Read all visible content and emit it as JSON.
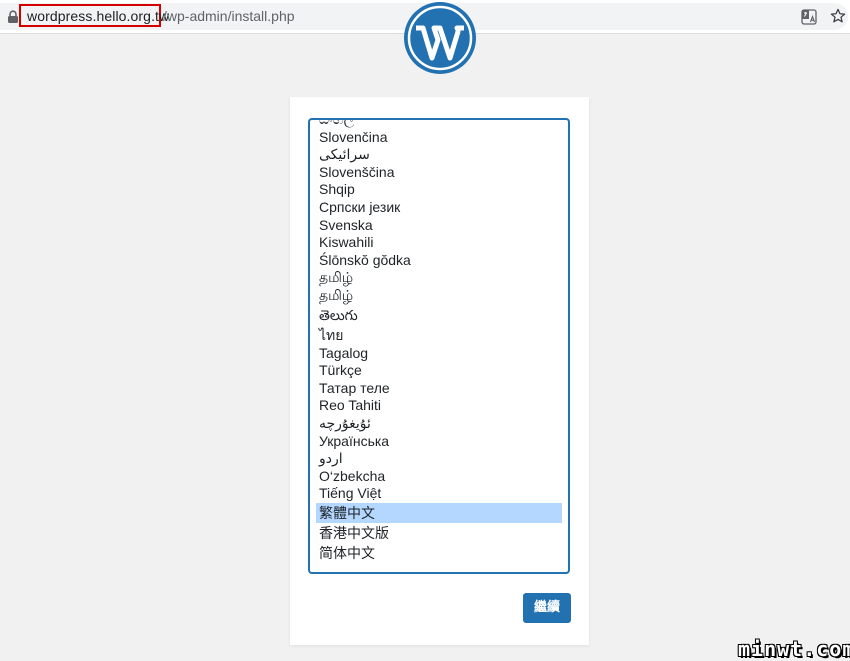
{
  "browser": {
    "url_domain": "wordpress.hello.org.tw",
    "url_path": "/wp-admin/install.php",
    "icons": [
      "lock-icon",
      "translate-icon",
      "star-icon"
    ]
  },
  "install": {
    "logo_icon": "wordpress-logo-icon",
    "language_options": [
      "සිංහල",
      "Slovenčina",
      "سرائیکی",
      "Slovenščina",
      "Shqip",
      "Српски језик",
      "Svenska",
      "Kiswahili",
      "Ślōnskŏ gŏdka",
      "தமிழ்",
      "தமிழ்",
      "తెలుగు",
      "ไทย",
      "Tagalog",
      "Türkçe",
      "Татар теле",
      "Reo Tahiti",
      "ئۇيغۇرچە",
      "Українська",
      "اردو",
      "O‘zbekcha",
      "Tiếng Việt",
      "繁體中文",
      "香港中文版",
      "简体中文"
    ],
    "selected_language": "繁體中文",
    "continue_label": "繼續"
  },
  "watermark": "minwt.com",
  "colors": {
    "accent": "#2271b1",
    "selection": "#b3d7ff",
    "highlight_box": "#d40000",
    "background": "#f1f1f1"
  }
}
